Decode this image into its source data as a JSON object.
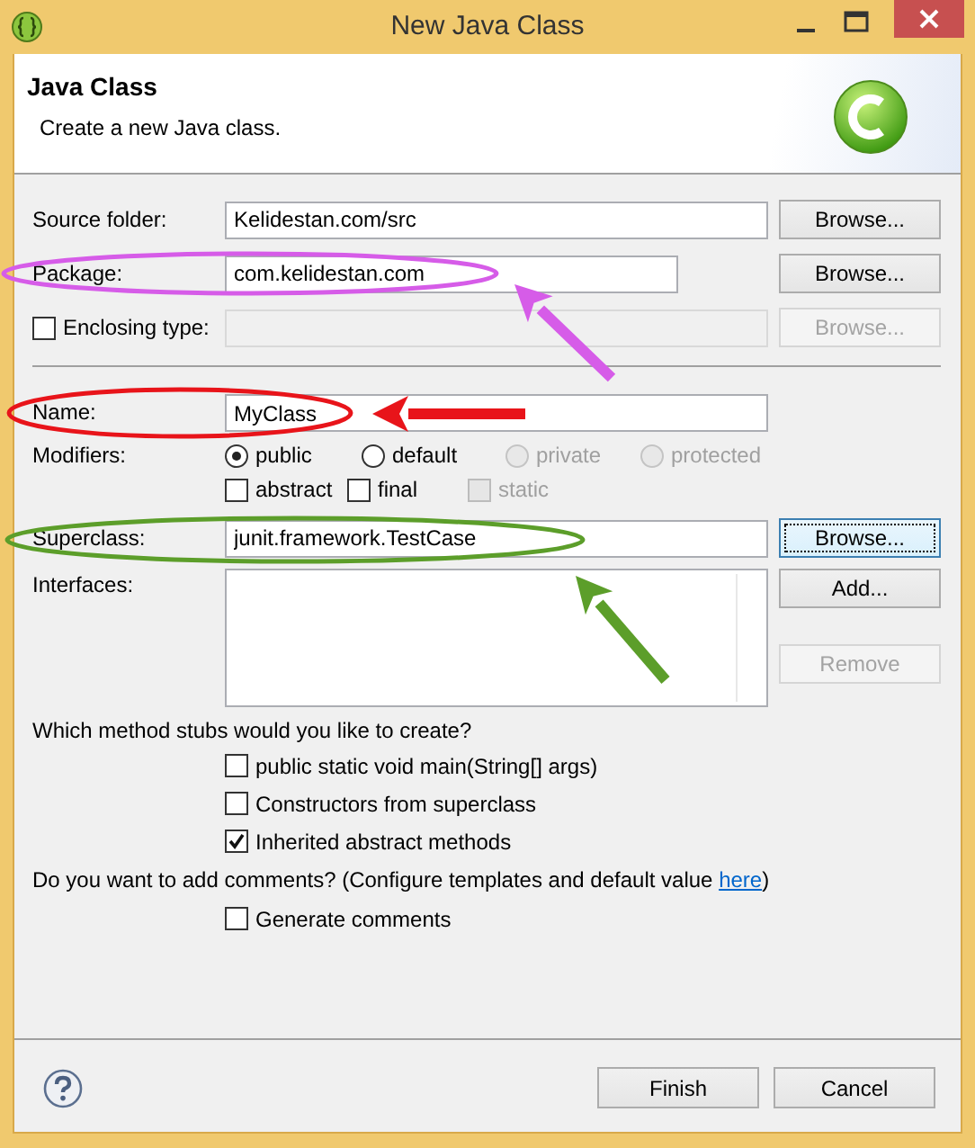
{
  "window": {
    "title": "New Java Class"
  },
  "banner": {
    "title": "Java Class",
    "description": "Create a new Java class."
  },
  "source_folder": {
    "label": "Source folder:",
    "value": "Kelidestan.com/src",
    "browse": {
      "label": "Browse...",
      "disabled": false,
      "focused": false
    }
  },
  "package": {
    "label": "Package:",
    "value": "com.kelidestan.com",
    "browse": {
      "label": "Browse...",
      "disabled": false,
      "focused": false
    }
  },
  "enclosing_type": {
    "label": "Enclosing type:",
    "checked": false,
    "disabled": true,
    "browse": {
      "label": "Browse...",
      "disabled": true,
      "focused": false
    }
  },
  "name": {
    "label": "Name:",
    "value": "MyClass"
  },
  "modifiers": {
    "label": "Modifiers:",
    "access": [
      {
        "label": "public",
        "selected": true,
        "disabled": false
      },
      {
        "label": "default",
        "selected": false,
        "disabled": false
      },
      {
        "label": "private",
        "selected": false,
        "disabled": true
      },
      {
        "label": "protected",
        "selected": false,
        "disabled": true
      }
    ],
    "other": [
      {
        "label": "abstract",
        "checked": false,
        "disabled": false
      },
      {
        "label": "final",
        "checked": false,
        "disabled": false
      },
      {
        "label": "static",
        "checked": false,
        "disabled": true
      }
    ]
  },
  "superclass": {
    "label": "Superclass:",
    "value": "junit.framework.TestCase",
    "browse": {
      "label": "Browse...",
      "disabled": false,
      "focused": true
    }
  },
  "interfaces": {
    "label": "Interfaces:",
    "buttons": [
      {
        "label": "Add...",
        "disabled": false
      },
      {
        "label": "Remove",
        "disabled": true
      }
    ]
  },
  "method_stubs": {
    "question": "Which method stubs would you like to create?",
    "options": [
      {
        "label": "public static void main(String[] args)",
        "checked": false
      },
      {
        "label": "Constructors from superclass",
        "checked": false
      },
      {
        "label": "Inherited abstract methods",
        "checked": true
      }
    ]
  },
  "comments": {
    "question": "Do you want to add comments? (Configure templates and default value ",
    "link": "here",
    "suffix": ")",
    "options": [
      {
        "label": "Generate comments",
        "checked": false
      }
    ]
  },
  "footer": {
    "buttons": [
      {
        "label": "Finish",
        "disabled": false
      },
      {
        "label": "Cancel",
        "disabled": false
      }
    ]
  },
  "annotations": [
    {
      "color": "#d65ce8"
    },
    {
      "color": "#e8141a"
    },
    {
      "color": "#5c9e2a"
    }
  ]
}
